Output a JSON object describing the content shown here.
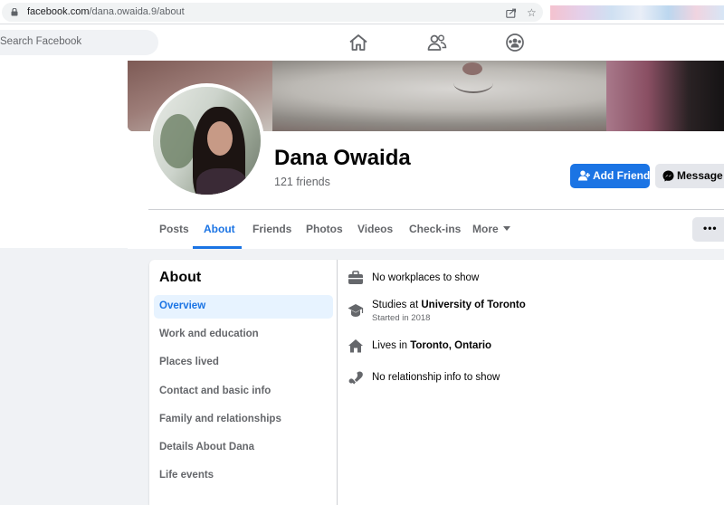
{
  "browser": {
    "url_host": "facebook.com",
    "url_path": "/dana.owaida.9/about"
  },
  "nav": {
    "search_placeholder": "Search Facebook",
    "icons": [
      "home-icon",
      "friends-icon",
      "groups-icon"
    ]
  },
  "profile": {
    "name": "Dana Owaida",
    "friends": "121 friends",
    "add_friend_label": "Add Friend",
    "message_label": "Message",
    "more_options_label": "•••"
  },
  "tabs": [
    {
      "label": "Posts",
      "active": false
    },
    {
      "label": "About",
      "active": true
    },
    {
      "label": "Friends",
      "active": false
    },
    {
      "label": "Photos",
      "active": false
    },
    {
      "label": "Videos",
      "active": false
    },
    {
      "label": "Check-ins",
      "active": false
    },
    {
      "label": "More",
      "active": false
    }
  ],
  "about": {
    "title": "About",
    "menu": [
      "Overview",
      "Work and education",
      "Places lived",
      "Contact and basic info",
      "Family and relationships",
      "Details About Dana",
      "Life events"
    ],
    "details": {
      "work": "No workplaces to show",
      "studies_prefix": "Studies at",
      "studies_school": "University of Toronto",
      "studies_since": "Started in 2018",
      "lives_prefix": "Lives in",
      "lives_city": "Toronto, Ontario",
      "relationship": "No relationship info to show"
    }
  },
  "colors": {
    "accent": "#1b74e4",
    "background": "#f0f2f5",
    "secondary_text": "#65676b"
  }
}
